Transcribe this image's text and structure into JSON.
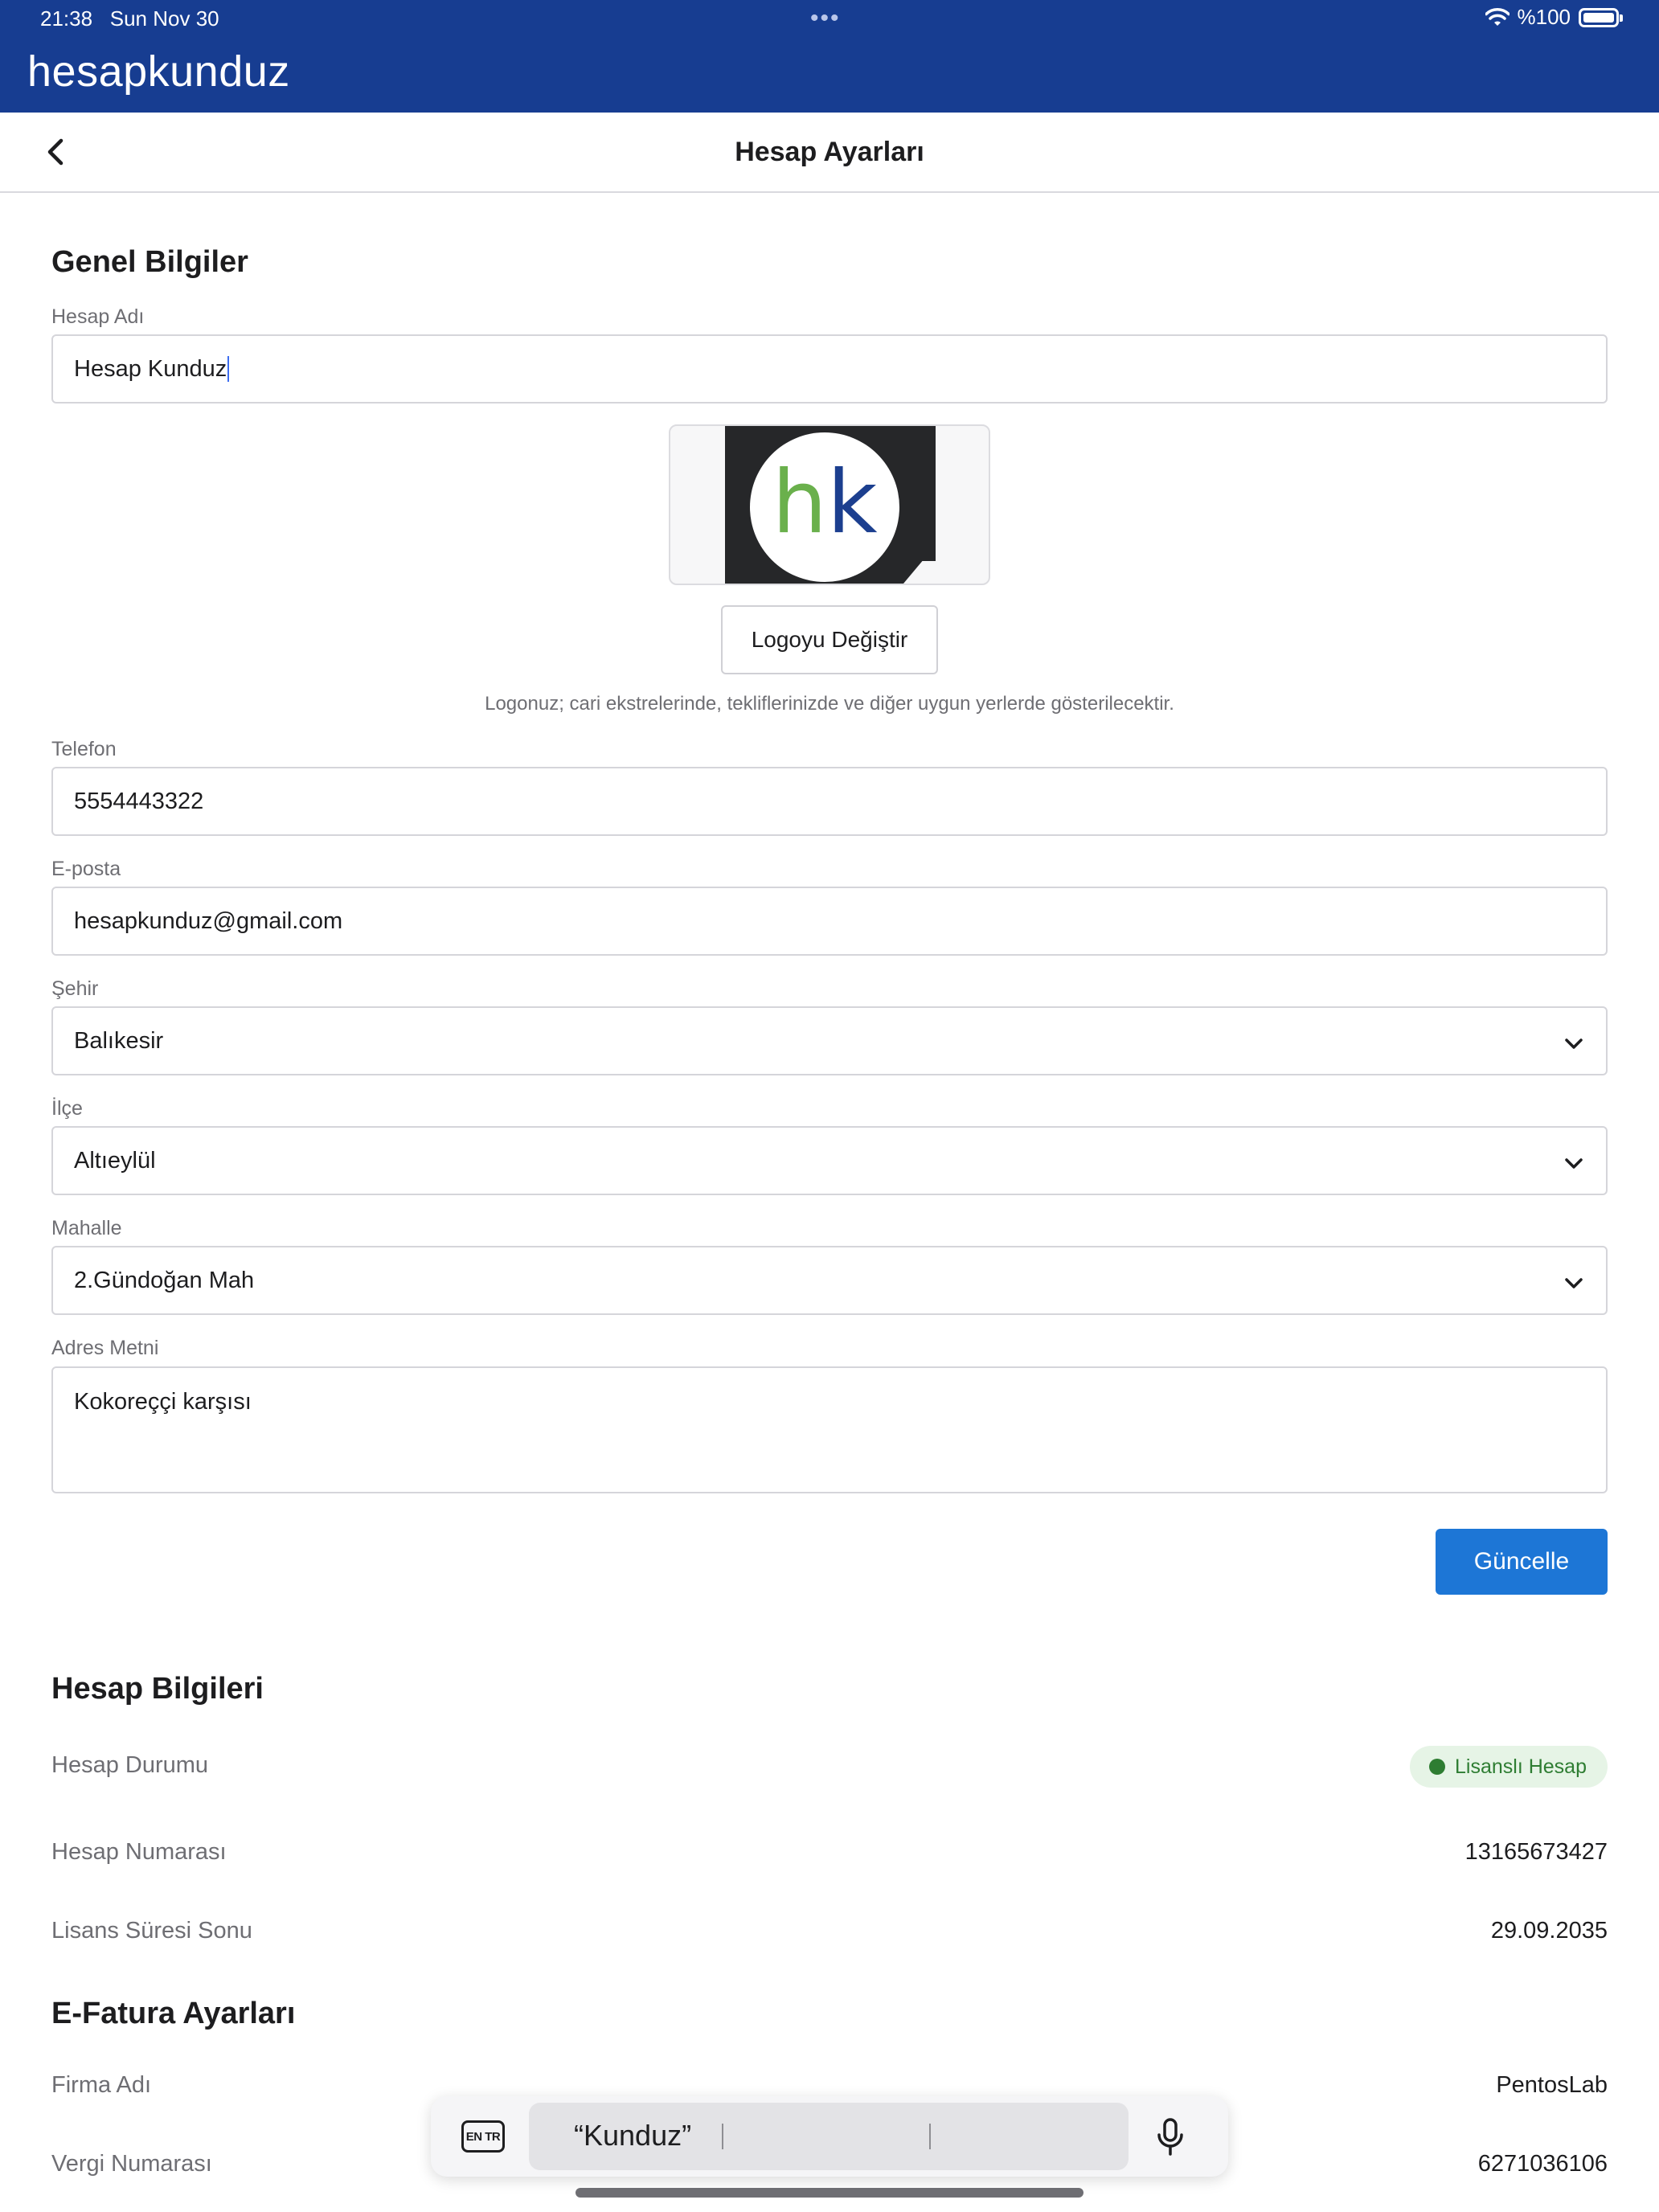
{
  "status_bar": {
    "time": "21:38",
    "date": "Sun Nov 30",
    "battery": "%100"
  },
  "app": {
    "logo_text": "hesapkunduz"
  },
  "nav": {
    "title": "Hesap Ayarları"
  },
  "general": {
    "section_title": "Genel Bilgiler",
    "account_name_label": "Hesap Adı",
    "account_name_value": "Hesap Kunduz",
    "logo_letters": {
      "h": "h",
      "k": "k"
    },
    "change_logo_label": "Logoyu Değiştir",
    "logo_hint": "Logonuz; cari ekstrelerinde, tekliflerinizde ve diğer uygun yerlerde gösterilecektir.",
    "phone_label": "Telefon",
    "phone_value": "5554443322",
    "email_label": "E-posta",
    "email_value": "hesapkunduz@gmail.com",
    "city_label": "Şehir",
    "city_value": "Balıkesir",
    "district_label": "İlçe",
    "district_value": "Altıeylül",
    "neighborhood_label": "Mahalle",
    "neighborhood_value": "2.Gündoğan Mah",
    "address_label": "Adres Metni",
    "address_value": "Kokoreççi karşısı",
    "update_label": "Güncelle"
  },
  "account_info": {
    "section_title": "Hesap Bilgileri",
    "status_label": "Hesap Durumu",
    "status_badge": "Lisanslı Hesap",
    "number_label": "Hesap Numarası",
    "number_value": "13165673427",
    "license_end_label": "Lisans Süresi Sonu",
    "license_end_value": "29.09.2035"
  },
  "einvoice": {
    "section_title": "E-Fatura Ayarları",
    "company_label": "Firma Adı",
    "company_value": "PentosLab",
    "tax_label": "Vergi Numarası",
    "tax_value": "6271036106"
  },
  "keyboard": {
    "lang_label": "EN TR",
    "suggestion": "“Kunduz”"
  },
  "colors": {
    "header_blue": "#173d91",
    "primary_button": "#1d76d6",
    "success_green": "#2e7d32"
  }
}
